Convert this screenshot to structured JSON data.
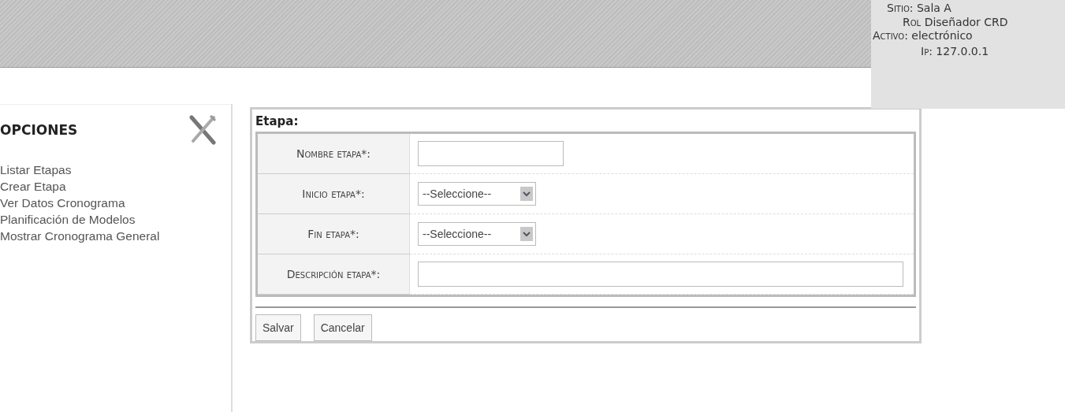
{
  "session": {
    "site": {
      "label": "Sitio:",
      "value": "Sala A"
    },
    "role": {
      "label": "Rol",
      "value": "Diseñador CRD"
    },
    "asset": {
      "label": "Activo:",
      "value": "electrónico"
    },
    "ip": {
      "label": "Ip:",
      "value": "127.0.0.1"
    }
  },
  "sidebar": {
    "title": "OPCIONES",
    "items": [
      {
        "label": "Listar Etapas"
      },
      {
        "label": "Crear Etapa"
      },
      {
        "label": "Ver Datos Cronograma"
      },
      {
        "label": "Planificación de Modelos"
      },
      {
        "label": "Mostrar Cronograma General"
      }
    ]
  },
  "form": {
    "title": "Etapa:",
    "fields": [
      {
        "label": "Nombre etapa*:",
        "kind": "text"
      },
      {
        "label": "Inicio etapa*:",
        "kind": "select",
        "value": "--Seleccione--"
      },
      {
        "label": "Fin etapa*:",
        "kind": "select",
        "value": "--Seleccione--"
      },
      {
        "label": "Descripción etapa*:",
        "kind": "wide"
      }
    ],
    "buttons": [
      "Salvar",
      "Cancelar"
    ]
  }
}
